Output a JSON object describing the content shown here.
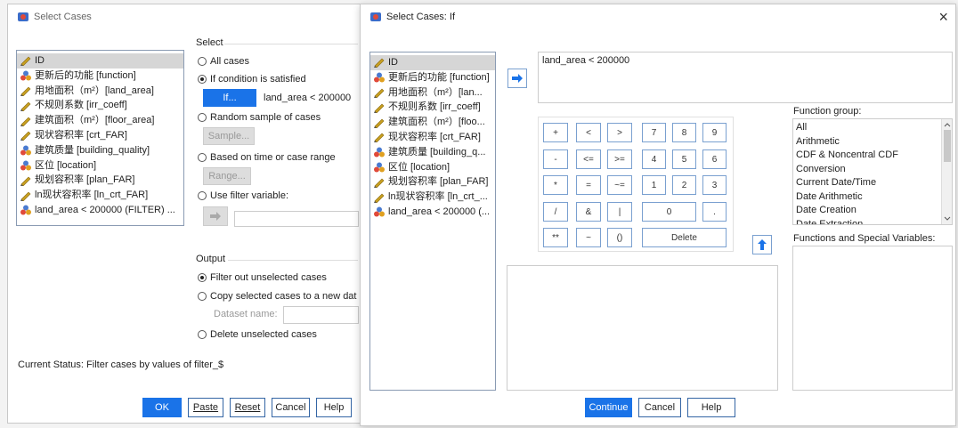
{
  "back_dialog": {
    "title": "Select Cases",
    "variables": [
      {
        "type": "scale",
        "label": "ID",
        "selected": true
      },
      {
        "type": "nominal",
        "label": "更新后的功能 [function]"
      },
      {
        "type": "scale",
        "label": "用地面积（m²）[land_area]"
      },
      {
        "type": "scale",
        "label": "不规则系数 [irr_coeff]"
      },
      {
        "type": "scale",
        "label": "建筑面积（m²）[floor_area]"
      },
      {
        "type": "scale",
        "label": "现状容积率 [crt_FAR]"
      },
      {
        "type": "nominal",
        "label": "建筑质量 [building_quality]"
      },
      {
        "type": "nominal",
        "label": "区位 [location]"
      },
      {
        "type": "scale",
        "label": "规划容积率 [plan_FAR]"
      },
      {
        "type": "scale",
        "label": "ln现状容积率 [ln_crt_FAR]"
      },
      {
        "type": "nominal",
        "label": "land_area < 200000 (FILTER) ..."
      }
    ],
    "select_group_label": "Select",
    "options": {
      "all_cases": "All cases",
      "if_condition": "If condition is satisfied",
      "if_button": "If...",
      "if_condition_text": "land_area < 200000",
      "random_sample": "Random sample of cases",
      "sample_button": "Sample...",
      "based_on_time": "Based on time or case range",
      "range_button": "Range...",
      "use_filter": "Use filter variable:"
    },
    "output_group_label": "Output",
    "output": {
      "filter_out": "Filter out unselected cases",
      "copy_selected": "Copy selected cases to a new dat",
      "dataset_name": "Dataset name:",
      "delete_unselected": "Delete unselected cases"
    },
    "current_status": "Current Status: Filter cases by values of filter_$",
    "buttons": {
      "ok": "OK",
      "paste": "Paste",
      "reset": "Reset",
      "cancel": "Cancel",
      "help": "Help"
    }
  },
  "front_dialog": {
    "title": "Select Cases: If",
    "close_glyph": "×",
    "variables": [
      {
        "type": "scale",
        "label": "ID",
        "selected": true
      },
      {
        "type": "nominal",
        "label": "更新后的功能 [function]"
      },
      {
        "type": "scale",
        "label": "用地面积（m²）[lan..."
      },
      {
        "type": "scale",
        "label": "不规则系数 [irr_coeff]"
      },
      {
        "type": "scale",
        "label": "建筑面积（m²）[floo..."
      },
      {
        "type": "scale",
        "label": "现状容积率 [crt_FAR]"
      },
      {
        "type": "nominal",
        "label": "建筑质量 [building_q..."
      },
      {
        "type": "nominal",
        "label": "区位 [location]"
      },
      {
        "type": "scale",
        "label": "规划容积率 [plan_FAR]"
      },
      {
        "type": "scale",
        "label": "ln现状容积率 [ln_crt_..."
      },
      {
        "type": "nominal",
        "label": "land_area < 200000 (..."
      }
    ],
    "expression": "land_area < 200000",
    "keypad": {
      "ops": [
        "+",
        "<",
        ">",
        "-",
        "<=",
        ">=",
        "*",
        "=",
        "~=",
        "/",
        "&",
        "|",
        "**",
        "~",
        "()"
      ],
      "digits": [
        "7",
        "8",
        "9",
        "4",
        "5",
        "6",
        "1",
        "2",
        "3"
      ],
      "zero": "0",
      "dot": ".",
      "delete": "Delete"
    },
    "function_group_label": "Function group:",
    "function_groups": [
      "All",
      "Arithmetic",
      "CDF & Noncentral CDF",
      "Conversion",
      "Current Date/Time",
      "Date Arithmetic",
      "Date Creation",
      "Date Extraction"
    ],
    "functions_label": "Functions and Special Variables:",
    "buttons": {
      "continue": "Continue",
      "cancel": "Cancel",
      "help": "Help"
    }
  },
  "colors": {
    "accent": "#1a73e8",
    "border": "#7aa0d0",
    "scale_icon": "#c8a020",
    "nominal_icon": "#4a7bd0"
  }
}
